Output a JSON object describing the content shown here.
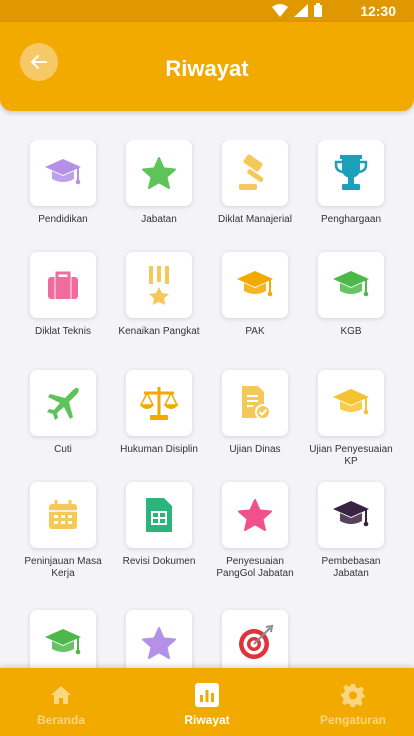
{
  "status": {
    "time": "12:30"
  },
  "header": {
    "title": "Riwayat"
  },
  "colors": {
    "primary": "#f2a900",
    "statusbar": "#e09800",
    "nav_active": "#ffffff",
    "nav_inactive": "#f9d780"
  },
  "items": [
    {
      "label": "Pendidikan",
      "icon": "graduation-cap-icon",
      "color": "#b490e8"
    },
    {
      "label": "Jabatan",
      "icon": "star-icon",
      "color": "#5ec45a"
    },
    {
      "label": "Diklat Manajerial",
      "icon": "gavel-icon",
      "color": "#f4c95a"
    },
    {
      "label": "Penghargaan",
      "icon": "trophy-icon",
      "color": "#1aa0b8"
    },
    {
      "label": "Diklat Teknis",
      "icon": "briefcase-icon",
      "color": "#f06b9e"
    },
    {
      "label": "Kenaikan Pangkat",
      "icon": "medal-icon",
      "color": "#f4c95a"
    },
    {
      "label": "PAK",
      "icon": "graduation-cap-icon",
      "color": "#f2a900"
    },
    {
      "label": "KGB",
      "icon": "graduation-cap-icon",
      "color": "#4cb84a"
    },
    {
      "label": "Cuti",
      "icon": "airplane-icon",
      "color": "#5ec45a"
    },
    {
      "label": "Hukuman Disiplin",
      "icon": "scales-icon",
      "color": "#f2a900"
    },
    {
      "label": "Ujian Dinas",
      "icon": "document-check-icon",
      "color": "#f4c95a"
    },
    {
      "label": "Ujian Penyesuaian KP",
      "icon": "graduation-cap-icon",
      "color": "#f4c430"
    },
    {
      "label": "Peninjauan Masa Kerja",
      "icon": "calendar-icon",
      "color": "#f4c95a"
    },
    {
      "label": "Revisi Dokumen",
      "icon": "spreadsheet-document-icon",
      "color": "#2bb57c"
    },
    {
      "label": "Penyesuaian PangGol Jabatan",
      "icon": "star-icon",
      "color": "#f0508c"
    },
    {
      "label": "Pembebasan Jabatan",
      "icon": "graduation-cap-icon",
      "color": "#3a2340"
    },
    {
      "label": "",
      "icon": "graduation-cap-icon",
      "color": "#4cb84a"
    },
    {
      "label": "",
      "icon": "star-icon",
      "color": "#b490e8"
    },
    {
      "label": "",
      "icon": "target-icon",
      "color": "#e0333a"
    }
  ],
  "bottom_nav": [
    {
      "label": "Beranda",
      "icon": "home-icon",
      "active": false
    },
    {
      "label": "Riwayat",
      "icon": "bar-chart-icon",
      "active": true
    },
    {
      "label": "Pengaturan",
      "icon": "gear-icon",
      "active": false
    }
  ]
}
